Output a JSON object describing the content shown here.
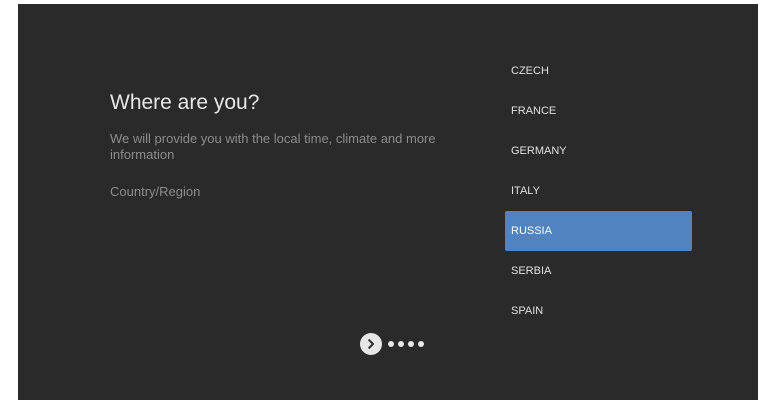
{
  "page": {
    "title": "Where are you?",
    "subtitle": "We will provide you with the local time, climate and more information",
    "field_label": "Country/Region"
  },
  "countries": [
    {
      "label": "CZECH",
      "selected": false
    },
    {
      "label": "FRANCE",
      "selected": false
    },
    {
      "label": "GERMANY",
      "selected": false
    },
    {
      "label": "ITALY",
      "selected": false
    },
    {
      "label": "RUSSIA",
      "selected": true
    },
    {
      "label": "SERBIA",
      "selected": false
    },
    {
      "label": "SPAIN",
      "selected": false
    }
  ],
  "pager": {
    "next_icon": "chevron-right-icon",
    "total_steps": 5,
    "current_step": 1
  },
  "colors": {
    "background": "#2a2a2a",
    "accent": "#5183c1",
    "text_primary": "#e6e6e6",
    "text_secondary": "#8c8c8c"
  }
}
